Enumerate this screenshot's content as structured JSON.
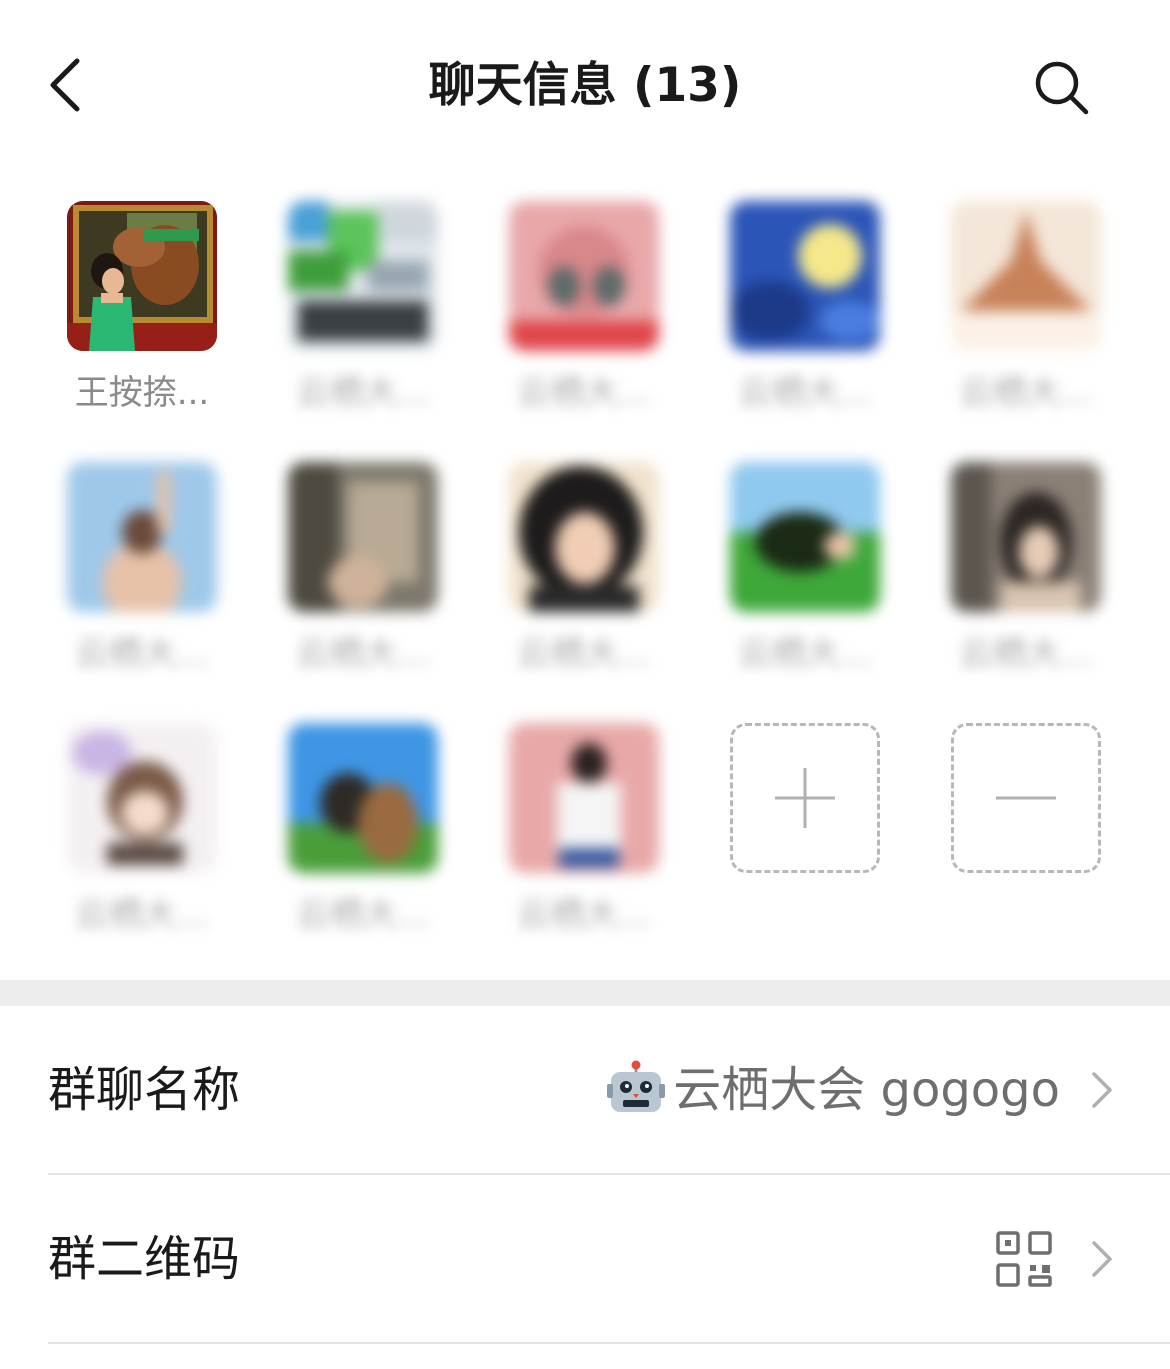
{
  "header": {
    "title": "聊天信息 (13)"
  },
  "members": [
    {
      "name": "王按捺...",
      "blurred": false
    },
    {
      "name": "云栖大...",
      "blurred": true
    },
    {
      "name": "云栖大...",
      "blurred": true
    },
    {
      "name": "云栖大...",
      "blurred": true
    },
    {
      "name": "云栖大...",
      "blurred": true
    },
    {
      "name": "云栖大...",
      "blurred": true
    },
    {
      "name": "云栖大...",
      "blurred": true
    },
    {
      "name": "云栖大...",
      "blurred": true
    },
    {
      "name": "云栖大...",
      "blurred": true
    },
    {
      "name": "云栖大...",
      "blurred": true
    },
    {
      "name": "云栖大...",
      "blurred": true
    },
    {
      "name": "云栖大...",
      "blurred": true
    },
    {
      "name": "云栖大...",
      "blurred": true
    }
  ],
  "settings": {
    "group_name_label": "群聊名称",
    "group_name_value": "云栖大会 gogogo",
    "group_qr_label": "群二维码"
  },
  "colors": {
    "page_bg": "#ededed",
    "card_bg": "#ffffff",
    "divider": "#e5e5e5"
  }
}
